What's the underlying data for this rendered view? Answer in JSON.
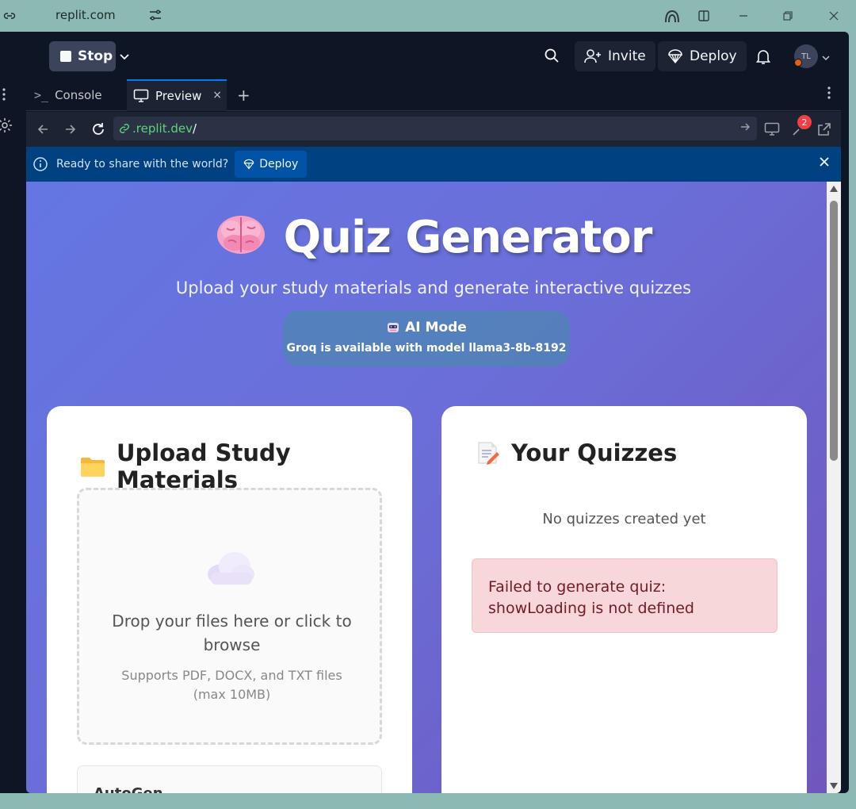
{
  "os": {
    "title": "replit.com"
  },
  "topbar": {
    "stop_label": "Stop",
    "invite_label": "Invite",
    "deploy_label": "Deploy",
    "avatar_initials": "TL"
  },
  "tabs": [
    {
      "label": "Console",
      "prefix": ">_"
    },
    {
      "label": "Preview",
      "close": "×"
    }
  ],
  "tab_plus": "+",
  "urlbar": {
    "url_host": ".replit.dev",
    "url_path": "/",
    "badge_count": "2"
  },
  "banner": {
    "message": "Ready to share with the world?",
    "deploy_label": "Deploy"
  },
  "page": {
    "title": "Quiz Generator",
    "subtitle": "Upload your study materials and generate interactive quizzes",
    "ai_mode": "AI Mode",
    "ai_model": "Groq is available with model llama3-8b-8192",
    "upload_heading": "Upload Study Materials",
    "drop_main": "Drop your files here or click to browse",
    "drop_sub": "Supports PDF, DOCX, and TXT files (max 10MB)",
    "autogen_label": "AutoGen",
    "quizzes_heading": "Your Quizzes",
    "no_quizzes": "No quizzes created yet",
    "error_message": "Failed to generate quiz: showLoading is not defined"
  },
  "colors": {
    "app_bg": "#0e1525",
    "accent": "#0079f2",
    "banner_bg": "#004182",
    "gradient_start": "#6476e3",
    "gradient_end": "#6f56bd",
    "error_bg": "#f8d7da"
  },
  "icons": [
    "link-icon",
    "tune-icon",
    "copilot-icon",
    "split-icon",
    "minimize-icon",
    "restore-icon",
    "close-icon",
    "chevron-down-icon",
    "search-icon",
    "person-add-icon",
    "deploy-icon",
    "bell-icon",
    "kebab-icon",
    "gear-icon",
    "monitor-icon",
    "back-icon",
    "forward-icon",
    "refresh-icon",
    "arrow-right-icon",
    "devtools-icon",
    "external-link-icon",
    "info-icon",
    "brain-icon",
    "robot-icon",
    "folder-icon",
    "memo-icon",
    "cloud-icon"
  ]
}
